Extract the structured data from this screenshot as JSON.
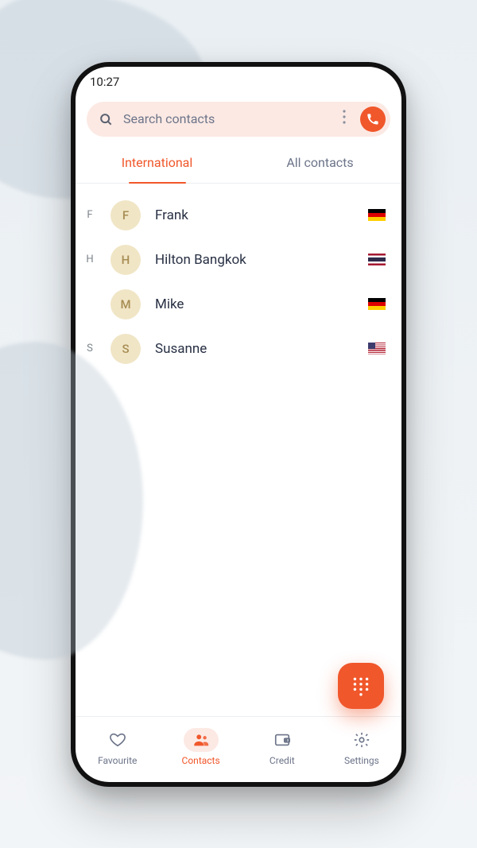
{
  "status": {
    "time": "10:27"
  },
  "search": {
    "placeholder": "Search contacts"
  },
  "tabs": {
    "items": [
      {
        "label": "International",
        "active": true
      },
      {
        "label": "All contacts",
        "active": false
      }
    ]
  },
  "contacts": [
    {
      "index": "F",
      "initial": "F",
      "name": "Frank",
      "flag": "de"
    },
    {
      "index": "H",
      "initial": "H",
      "name": "Hilton Bangkok",
      "flag": "th"
    },
    {
      "index": "",
      "initial": "M",
      "name": "Mike",
      "flag": "de"
    },
    {
      "index": "S",
      "initial": "S",
      "name": "Susanne",
      "flag": "us"
    }
  ],
  "bottom_nav": {
    "items": [
      {
        "key": "favourite",
        "label": "Favourite",
        "active": false
      },
      {
        "key": "contacts",
        "label": "Contacts",
        "active": true
      },
      {
        "key": "credit",
        "label": "Credit",
        "active": false
      },
      {
        "key": "settings",
        "label": "Settings",
        "active": false
      }
    ]
  },
  "colors": {
    "accent": "#f0572b"
  }
}
